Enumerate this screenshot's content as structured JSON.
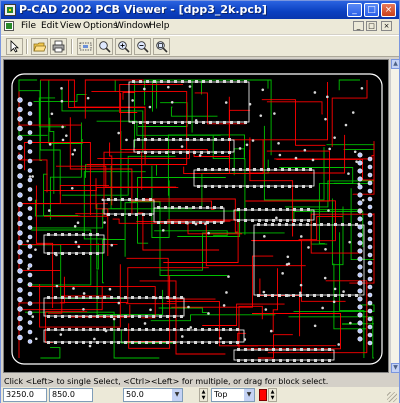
{
  "window": {
    "title": "P-CAD 2002 PCB Viewer - [dpp3_2k.pcb]",
    "controls": {
      "minimize": "_",
      "maximize": "□",
      "close": "×"
    }
  },
  "menubar": {
    "items": [
      {
        "label": "File"
      },
      {
        "label": "Edit"
      },
      {
        "label": "View"
      },
      {
        "label": "Options"
      },
      {
        "label": "Window"
      },
      {
        "label": "Help"
      }
    ],
    "mdi_controls": {
      "minimize": "_",
      "restore": "□",
      "close": "×"
    }
  },
  "toolbar": {
    "buttons": [
      {
        "icon": "pointer-icon"
      },
      {
        "icon": "open-folder-icon"
      },
      {
        "icon": "print-icon"
      },
      {
        "icon": "zoom-window-icon"
      },
      {
        "icon": "zoom-region-icon"
      },
      {
        "icon": "zoom-in-icon"
      },
      {
        "icon": "zoom-out-icon"
      },
      {
        "icon": "zoom-fit-icon"
      }
    ]
  },
  "status": {
    "message": "Click <Left> to single Select, <Ctrl><Left> for multiple, or drag for block select.",
    "x_coord": "3250.0",
    "y_coord": "850.0",
    "grid": "50.0",
    "layer": "Top",
    "layer_color": "#ff0000"
  },
  "colors": {
    "board_background": "#000000",
    "top_copper": "#ff0000",
    "bottom_copper": "#00c000",
    "silkscreen": "#ffffff",
    "pads": "#d8d8d8"
  }
}
